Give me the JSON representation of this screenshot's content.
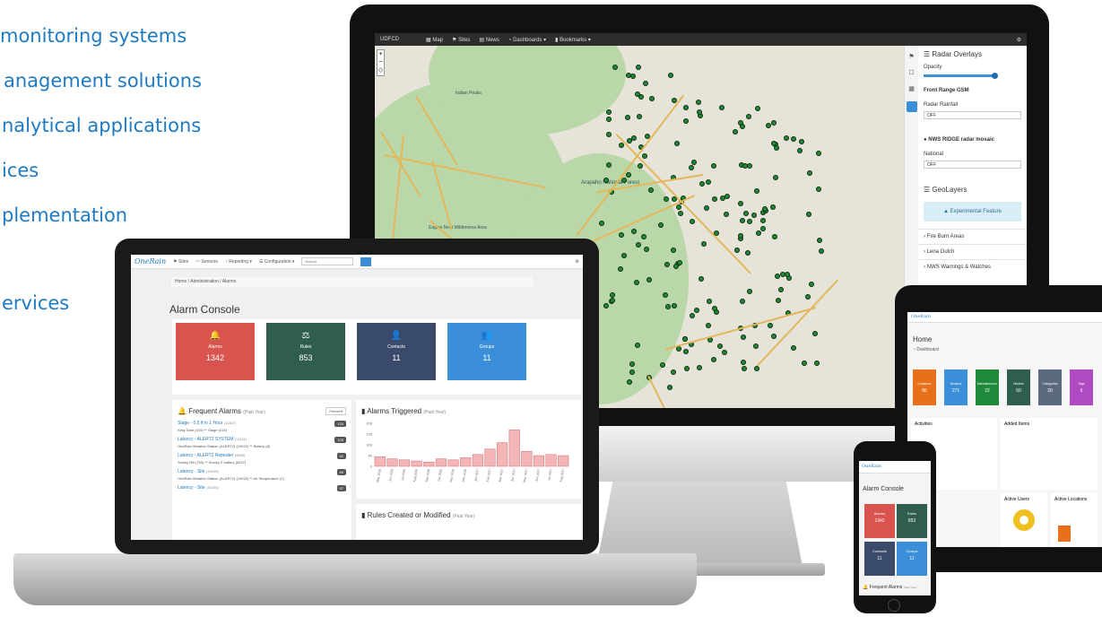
{
  "bullets": [
    "monitoring systems",
    "anagement solutions",
    "nalytical applications",
    "ices",
    "plementation",
    "ervices"
  ],
  "colors": {
    "accent": "#1f7ac4",
    "red": "#d9534f",
    "green": "#2f5e4d",
    "navy": "#3a4a6b",
    "blue": "#3b8fd9"
  },
  "monitor": {
    "nav": {
      "brand": "UDFCD",
      "map": "Map",
      "sites": "Sites",
      "news": "News",
      "dashboards": "Dashboards ▾",
      "bookmarks": "Bookmarks ▾"
    },
    "panel": {
      "radar_title": "Radar Overlays",
      "opacity": "Opacity",
      "front_range": "Front Range GSM",
      "radar_rainfall": "Radar Rainfall",
      "off1": "OFF",
      "nws_ridge": "NWS RIDGE radar mosaic",
      "national": "National",
      "off2": "OFF",
      "geolayers": "GeoLayers",
      "experimental": "Experimental Feature",
      "fire": "Fire Burn Areas",
      "lena": "Lena Gulch",
      "warnings": "NWS Warnings & Watches"
    },
    "map_labels": [
      "Arapaho National Forest",
      "Eagles Nest Wilderness Area",
      "Indian Peaks"
    ]
  },
  "laptop": {
    "nav": {
      "logo": "OneRain",
      "sites": "Sites",
      "sensors": "Sensors",
      "reporting": "Reporting ▾",
      "configuration": "Configuration ▾",
      "search_placeholder": "Search"
    },
    "breadcrumb": {
      "home": "Home",
      "admin": "Administration",
      "alarms": "Alarms"
    },
    "title": "Alarm Console",
    "tiles": [
      {
        "label": "Alarms",
        "value": "1342",
        "icon": "🔔",
        "color": "#d9534f"
      },
      {
        "label": "Rules",
        "value": "853",
        "icon": "⚖",
        "color": "#2f5e4d"
      },
      {
        "label": "Contacts",
        "value": "11",
        "icon": "👤",
        "color": "#3a4a6b"
      },
      {
        "label": "Groups",
        "value": "11",
        "icon": "👥",
        "color": "#3b8fd9"
      }
    ],
    "frequent": {
      "title": "Frequent Alarms",
      "sub": "(Past Year)",
      "period": "Period ▾",
      "rows": [
        {
          "name": "Stage - 0.5 ft in 1 Hour",
          "id": "(11347)",
          "detail": "Kelly Dam (415) ** Stage (413)",
          "count": "134"
        },
        {
          "name": "Latency - ALERT2 SYSTEM",
          "id": "(11131)",
          "detail": "OneRain Weather Station (ALERT2) (10022) ** Battery (8)",
          "count": "105"
        },
        {
          "name": "Latency - ALERT2 Repeater",
          "id": "(9803)",
          "detail": "Smoky Hill (740) ** Smoky 2 battery (8107)",
          "count": "60"
        },
        {
          "name": "Latency - Site",
          "id": "(10200)",
          "detail": "OneRain Weather Station (ALERT2) (10022) ** Air Temperature (1)",
          "count": "60"
        },
        {
          "name": "Latency - Site",
          "id": "(10200)",
          "detail": "",
          "count": "57"
        }
      ]
    },
    "triggered": {
      "title": "Alarms Triggered",
      "sub": "(Past Year)"
    },
    "rules": {
      "title": "Rules Created or Modified",
      "sub": "(Past Year)"
    }
  },
  "chart_data": {
    "type": "bar",
    "title": "Alarms Triggered (Past Year)",
    "categories": [
      "May 2016",
      "Jun 2016",
      "Jul 2016",
      "Aug 2016",
      "Sep 2016",
      "Oct 2016",
      "Nov 2016",
      "Dec 2016",
      "Jan 2017",
      "Feb 2017",
      "Mar 2017",
      "Apr 2017",
      "May 2017",
      "Jun 2017",
      "Jul 2017",
      "Aug 2017"
    ],
    "values": [
      45,
      35,
      30,
      25,
      20,
      35,
      30,
      40,
      55,
      80,
      110,
      170,
      70,
      50,
      55,
      50
    ],
    "ylim": [
      0,
      200
    ],
    "yticks": [
      "200",
      "150",
      "100",
      "50",
      "0"
    ]
  },
  "tablet": {
    "title": "Home",
    "dashboard": "Dashboard",
    "tiles": [
      {
        "label": "Locations",
        "value": "86",
        "color": "#e8701a"
      },
      {
        "label": "Sensors",
        "value": "271",
        "color": "#3b8fd9"
      },
      {
        "label": "Manufacturers",
        "value": "22",
        "color": "#1e8a3a"
      },
      {
        "label": "Models",
        "value": "50",
        "color": "#2f5e4d"
      },
      {
        "label": "Categories",
        "value": "20",
        "color": "#5c6a7f"
      },
      {
        "label": "Tags",
        "value": "6",
        "color": "#b04ac0"
      }
    ],
    "activities": "Activities",
    "added": "Added Items",
    "active_users": "Active Users",
    "active_locations": "Active Locations"
  },
  "phone": {
    "title": "Alarm Console",
    "tiles": [
      {
        "label": "Alarms",
        "value": "1342",
        "color": "#d9534f"
      },
      {
        "label": "Rules",
        "value": "853",
        "color": "#2f5e4d"
      },
      {
        "label": "Contacts",
        "value": "11",
        "color": "#3a4a6b"
      },
      {
        "label": "Groups",
        "value": "11",
        "color": "#3b8fd9"
      }
    ],
    "frequent": "Frequent Alarms",
    "sub": "(Past Year)"
  }
}
